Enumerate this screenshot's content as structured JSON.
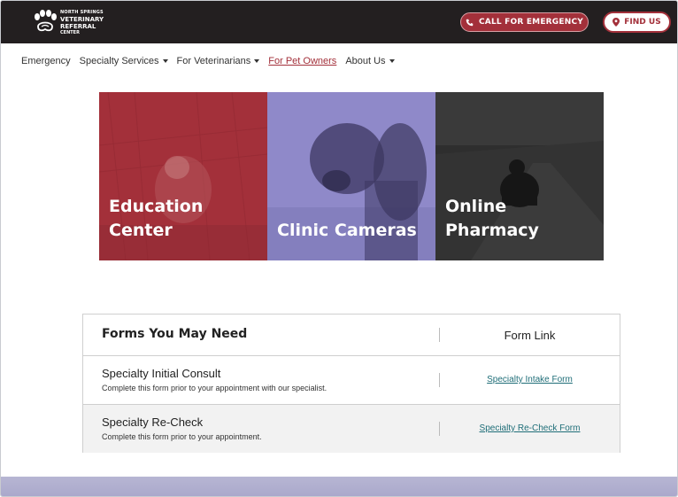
{
  "header": {
    "logo_lines": [
      "NORTH SPRINGS",
      "VETERINARY",
      "REFERRAL",
      "CENTER"
    ],
    "emergency_button": "CALL FOR EMERGENCY",
    "find_button": "FIND US"
  },
  "nav": {
    "items": [
      {
        "label": "Emergency"
      },
      {
        "label": "Specialty Services"
      },
      {
        "label": "For Veterinarians"
      },
      {
        "label": "For Pet Owners"
      },
      {
        "label": "About Us"
      }
    ]
  },
  "tiles": [
    {
      "label": "Education\nCenter",
      "color": "#a3303a"
    },
    {
      "label": "Clinic Cameras",
      "color": "#8f89c9"
    },
    {
      "label": "Online\nPharmacy",
      "color": "#2b2b2b"
    }
  ],
  "forms": {
    "title": "Forms You May Need",
    "link_header": "Form Link",
    "rows": [
      {
        "title": "Specialty Initial Consult",
        "desc": "Complete this form prior to your appointment with our specialist.",
        "link": "Specialty Intake Form"
      },
      {
        "title": "Specialty Re-Check",
        "desc": "Complete this form prior to your appointment.",
        "link": "Specialty Re-Check Form"
      }
    ]
  },
  "colors": {
    "brand_red": "#a3303a",
    "topbar": "#231f20",
    "link_teal": "#1f6e78",
    "lavender": "#8f89c9"
  }
}
